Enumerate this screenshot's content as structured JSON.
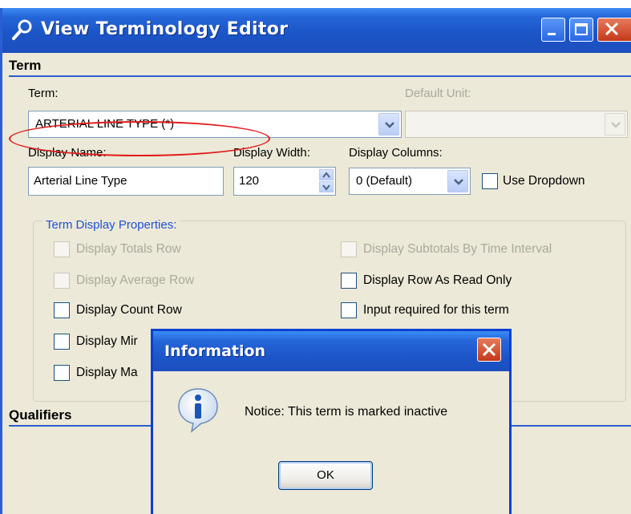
{
  "window": {
    "title": "View Terminology Editor"
  },
  "term_section": {
    "heading": "Term",
    "term_label": "Term:",
    "term_value": "ARTERIAL LINE TYPE (*)",
    "default_unit_label": "Default Unit:",
    "default_unit_value": "",
    "display_name_label": "Display Name:",
    "display_name_value": "Arterial Line Type",
    "display_width_label": "Display Width:",
    "display_width_value": "120",
    "display_columns_label": "Display Columns:",
    "display_columns_value": "0 (Default)",
    "use_dropdown_label": "Use Dropdown"
  },
  "display_properties": {
    "title": "Term Display Properties:",
    "left": [
      {
        "label": "Display Totals Row",
        "enabled": false
      },
      {
        "label": "Display Average Row",
        "enabled": false
      },
      {
        "label": "Display Count Row",
        "enabled": true
      },
      {
        "label": "Display Mir",
        "enabled": true
      },
      {
        "label": "Display Ma",
        "enabled": true
      }
    ],
    "right": [
      {
        "label": "Display Subtotals By Time Interval",
        "enabled": false
      },
      {
        "label": "Display Row As Read Only",
        "enabled": true
      },
      {
        "label": "Input required for this term",
        "enabled": true
      }
    ]
  },
  "qualifiers_section": {
    "heading": "Qualifiers"
  },
  "dialog": {
    "title": "Information",
    "message": "Notice: This term is marked inactive",
    "ok_label": "OK"
  },
  "colors": {
    "titlebar": "#2465d8",
    "annotation": "#e11c1c",
    "group_title": "#2050d8"
  }
}
